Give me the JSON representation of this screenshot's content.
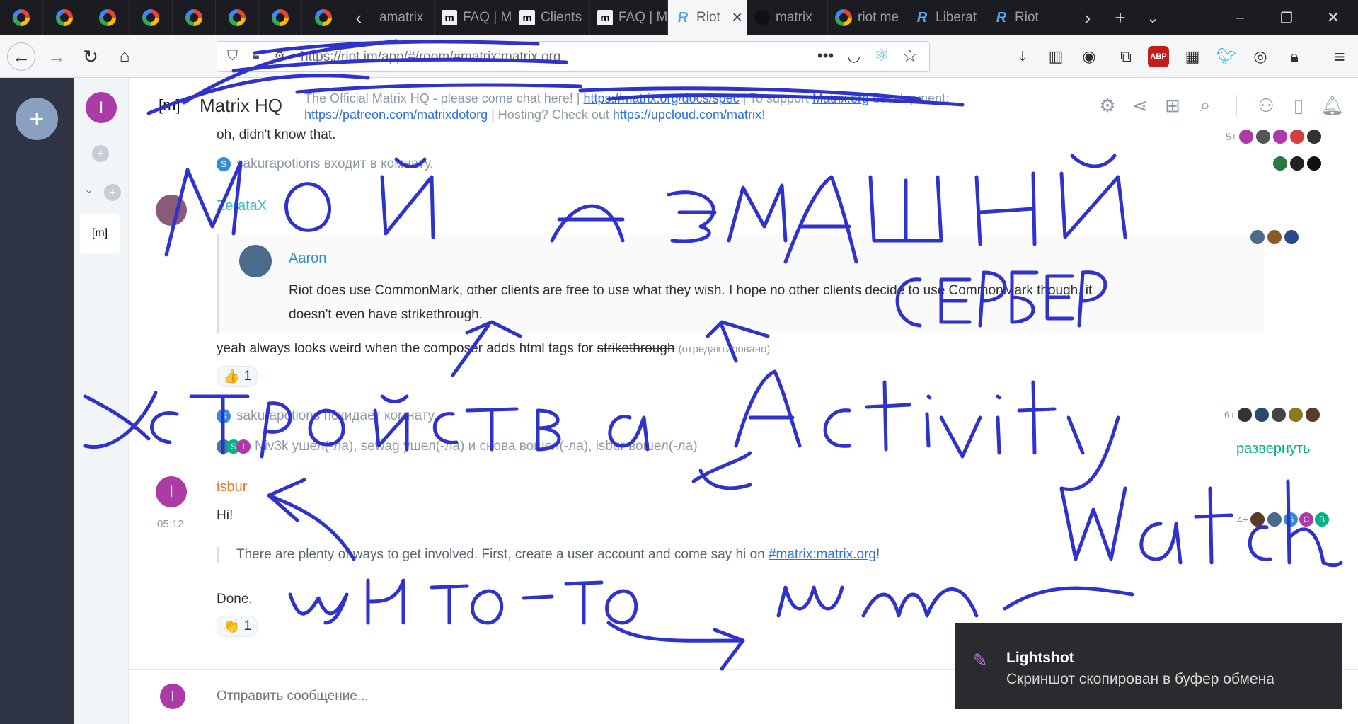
{
  "browser": {
    "tabs": [
      {
        "label": "",
        "icon": "google-icon"
      },
      {
        "label": "",
        "icon": "google-icon"
      },
      {
        "label": "",
        "icon": "google-icon"
      },
      {
        "label": "",
        "icon": "google-icon"
      },
      {
        "label": "",
        "icon": "google-icon"
      },
      {
        "label": "",
        "icon": "google-icon"
      },
      {
        "label": "",
        "icon": "google-icon"
      },
      {
        "label": "",
        "icon": "google-icon"
      },
      {
        "label": "amatrix",
        "icon": ""
      },
      {
        "label": "FAQ | M",
        "icon": "matrix-icon"
      },
      {
        "label": "Clients",
        "icon": "matrix-icon"
      },
      {
        "label": "FAQ | M",
        "icon": "matrix-icon"
      },
      {
        "label": "Riot",
        "icon": "riot-icon"
      },
      {
        "label": "matrix",
        "icon": "github-icon"
      },
      {
        "label": "riot me",
        "icon": "google-icon"
      },
      {
        "label": "Liberat",
        "icon": "riot-icon"
      },
      {
        "label": "Riot",
        "icon": "riot-icon"
      }
    ],
    "active_tab_index": 12,
    "url": "https://riot.im/app/#/room/#matrix:matrix.org",
    "window_controls": {
      "minimize": "–",
      "restore": "❐",
      "close": "✕"
    }
  },
  "room": {
    "name": "Matrix HQ",
    "avatar_letter": "[m]",
    "topic_prefix": "The Official Matrix HQ - please come chat here! | ",
    "topic_link1": "https://matrix.org/docs/spec",
    "topic_mid": " | To support ",
    "topic_link2": "Matrix.org",
    "topic_mid2": " development: ",
    "topic_link3": "https://patreon.com/matrixdotorg",
    "topic_mid3": " | Hosting? Check out ",
    "topic_link4": "https://upcloud.com/matrix",
    "topic_end": "!"
  },
  "sidebar": {
    "user_avatar_letter": "I",
    "room_tile_label": "[m]"
  },
  "timeline": {
    "top_message": "oh, didn't know that.",
    "top_receipt_count": "5+",
    "join_line_1": "sakurapotions входит в комнату.",
    "zeratax": {
      "name": "ZerataX",
      "quote_author": "Aaron",
      "quote_text": "Riot does use CommonMark, other clients are free to use what they wish. I hope no other clients decide to use CommonMark though, it doesn't even have strikethrough.",
      "reply_prefix": "yeah always looks weird when the composer adds html tags for ",
      "reply_strike": "strikethrough",
      "edited": "(отредактировано)",
      "reaction_emoji": "👍",
      "reaction_count": "1"
    },
    "leave_line": "sakurapotions покидает комнату.",
    "leave_receipt_count": "6+",
    "summary_line": "Niv3k ушел(-ла), sewag ушел(-ла) и снова вошел(-ла), isbur вошел(-ла)",
    "expand_label": "развернуть",
    "isbur": {
      "name": "isbur",
      "time": "05:12",
      "msg1": "Hi!",
      "quote_text": "There are plenty of ways to get involved. First, create a user account and come say hi on ",
      "quote_link": "#matrix:matrix.org",
      "quote_end": "!",
      "msg2": "Done.",
      "reaction_emoji": "👏",
      "reaction_count": "1",
      "receipt_count": "4+"
    }
  },
  "composer": {
    "placeholder": "Отправить сообщение..."
  },
  "toast": {
    "title": "Lightshot",
    "text": "Скриншот скопирован в буфер обмена"
  },
  "colors": {
    "accent_green": "#03b381",
    "isbur_orange": "#e97520",
    "zeratax_teal": "#2dc2c5",
    "aaron_blue": "#368bd6",
    "avatar_purple": "#ac3ba8",
    "ink": "#2f33cc"
  }
}
